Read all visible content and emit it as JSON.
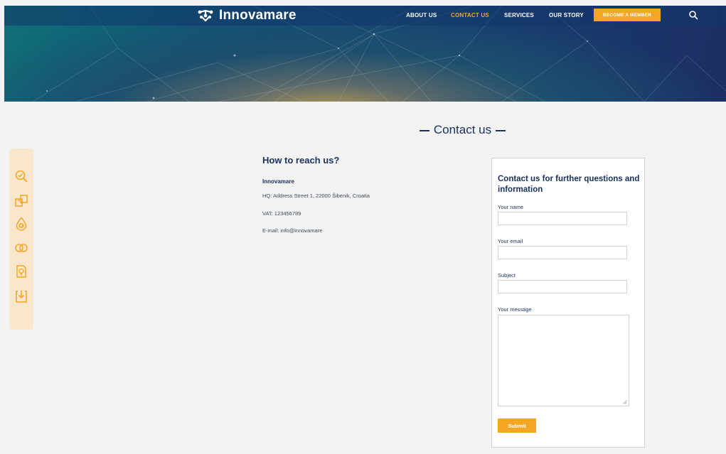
{
  "header": {
    "brand": "Innovamare",
    "nav": [
      {
        "label": "ABOUT US"
      },
      {
        "label": "CONTACT US"
      },
      {
        "label": "SERVICES"
      },
      {
        "label": "OUR STORY"
      }
    ],
    "member_button": "BECOME A MEMBER",
    "active_color": "#f5a623"
  },
  "side_toolbar": {
    "icons": [
      "search-check-icon",
      "puzzle-icon",
      "euro-drop-icon",
      "rings-icon",
      "idea-document-icon",
      "download-icon"
    ],
    "icon_color": "#f5a623"
  },
  "page_title": "Contact us",
  "reach": {
    "title": "How to reach us?",
    "org": "Innovamare",
    "address": "HQ: Address Street 1, 22000 Šibenik, Croatia",
    "vat": "VAT: 123456789",
    "email": "E-mail: info@innovamare"
  },
  "form": {
    "title": "Contact us for further questions and information",
    "name_label": "Your name",
    "email_label": "Your email",
    "subject_label": "Subject",
    "message_label": "Your message",
    "submit_label": "Submit"
  },
  "colors": {
    "brand_navy": "#17305e",
    "accent_orange": "#f5a623"
  }
}
